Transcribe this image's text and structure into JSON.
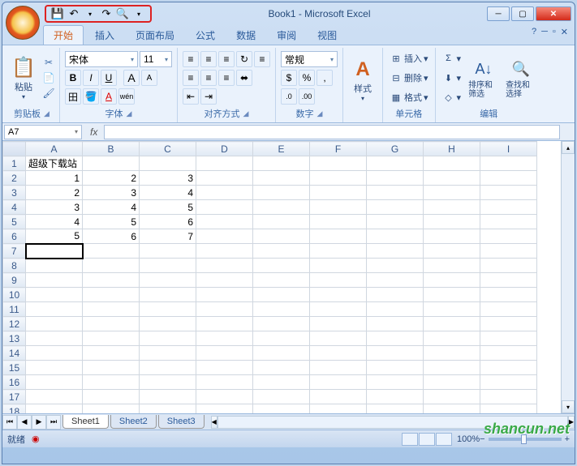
{
  "title": "Book1 - Microsoft Excel",
  "qat": {
    "save": "💾",
    "undo": "↶",
    "redo": "↷",
    "preview": "🔍",
    "dd": "▾"
  },
  "tabs": [
    "开始",
    "插入",
    "页面布局",
    "公式",
    "数据",
    "审阅",
    "视图"
  ],
  "ribbon": {
    "clipboard": {
      "label": "剪贴板",
      "paste": "粘贴",
      "cut": "✂",
      "copy": "📄",
      "brush": "🖌"
    },
    "font": {
      "label": "字体",
      "name": "宋体",
      "size": "11",
      "grow": "A",
      "shrink": "A",
      "bold": "B",
      "italic": "I",
      "underline": "U",
      "border": "田",
      "fill": "🪣",
      "color": "A",
      "r3a": "⎡",
      "r3b": "⎦",
      "phon": "wén"
    },
    "align": {
      "label": "对齐方式",
      "tl": "≡",
      "tc": "≡",
      "tr": "≡",
      "wrap": "≡",
      "ml": "≡",
      "mc": "≡",
      "mr": "≡",
      "merge": "⬌",
      "il": "⇤",
      "ir": "⇥",
      "orient": "↻"
    },
    "number": {
      "label": "数字",
      "format": "常规",
      "currency": "$",
      "percent": "%",
      "comma": ",",
      "inc": ".0",
      "dec": ".00"
    },
    "styles": {
      "label": "样式",
      "btn": "样式",
      "ico": "A"
    },
    "cells": {
      "label": "单元格",
      "insert": "插入",
      "delete": "删除",
      "format": "格式"
    },
    "editing": {
      "label": "编辑",
      "sum": "Σ",
      "fill": "⬇",
      "clear": "◇",
      "sort": "排序和筛选",
      "find": "查找和选择",
      "sortico": "A↓",
      "findico": "🔍"
    }
  },
  "namebox": "A7",
  "fx": "fx",
  "columns": [
    "A",
    "B",
    "C",
    "D",
    "E",
    "F",
    "G",
    "H",
    "I"
  ],
  "rows": [
    {
      "n": 1,
      "c": [
        "超级下载站",
        "",
        "",
        "",
        "",
        "",
        "",
        "",
        ""
      ]
    },
    {
      "n": 2,
      "c": [
        "1",
        "2",
        "3",
        "",
        "",
        "",
        "",
        "",
        ""
      ]
    },
    {
      "n": 3,
      "c": [
        "2",
        "3",
        "4",
        "",
        "",
        "",
        "",
        "",
        ""
      ]
    },
    {
      "n": 4,
      "c": [
        "3",
        "4",
        "5",
        "",
        "",
        "",
        "",
        "",
        ""
      ]
    },
    {
      "n": 5,
      "c": [
        "4",
        "5",
        "6",
        "",
        "",
        "",
        "",
        "",
        ""
      ]
    },
    {
      "n": 6,
      "c": [
        "5",
        "6",
        "7",
        "",
        "",
        "",
        "",
        "",
        ""
      ]
    },
    {
      "n": 7,
      "c": [
        "",
        "",
        "",
        "",
        "",
        "",
        "",
        "",
        ""
      ]
    },
    {
      "n": 8,
      "c": [
        "",
        "",
        "",
        "",
        "",
        "",
        "",
        "",
        ""
      ]
    },
    {
      "n": 9,
      "c": [
        "",
        "",
        "",
        "",
        "",
        "",
        "",
        "",
        ""
      ]
    },
    {
      "n": 10,
      "c": [
        "",
        "",
        "",
        "",
        "",
        "",
        "",
        "",
        ""
      ]
    },
    {
      "n": 11,
      "c": [
        "",
        "",
        "",
        "",
        "",
        "",
        "",
        "",
        ""
      ]
    },
    {
      "n": 12,
      "c": [
        "",
        "",
        "",
        "",
        "",
        "",
        "",
        "",
        ""
      ]
    },
    {
      "n": 13,
      "c": [
        "",
        "",
        "",
        "",
        "",
        "",
        "",
        "",
        ""
      ]
    },
    {
      "n": 14,
      "c": [
        "",
        "",
        "",
        "",
        "",
        "",
        "",
        "",
        ""
      ]
    },
    {
      "n": 15,
      "c": [
        "",
        "",
        "",
        "",
        "",
        "",
        "",
        "",
        ""
      ]
    },
    {
      "n": 16,
      "c": [
        "",
        "",
        "",
        "",
        "",
        "",
        "",
        "",
        ""
      ]
    },
    {
      "n": 17,
      "c": [
        "",
        "",
        "",
        "",
        "",
        "",
        "",
        "",
        ""
      ]
    },
    {
      "n": 18,
      "c": [
        "",
        "",
        "",
        "",
        "",
        "",
        "",
        "",
        ""
      ]
    }
  ],
  "active_cell": "A7",
  "sheets": [
    "Sheet1",
    "Sheet2",
    "Sheet3"
  ],
  "status": {
    "ready": "就绪",
    "rec": "◉",
    "zoom": "100%",
    "minus": "−",
    "plus": "+"
  },
  "watermark": "shancun.net"
}
